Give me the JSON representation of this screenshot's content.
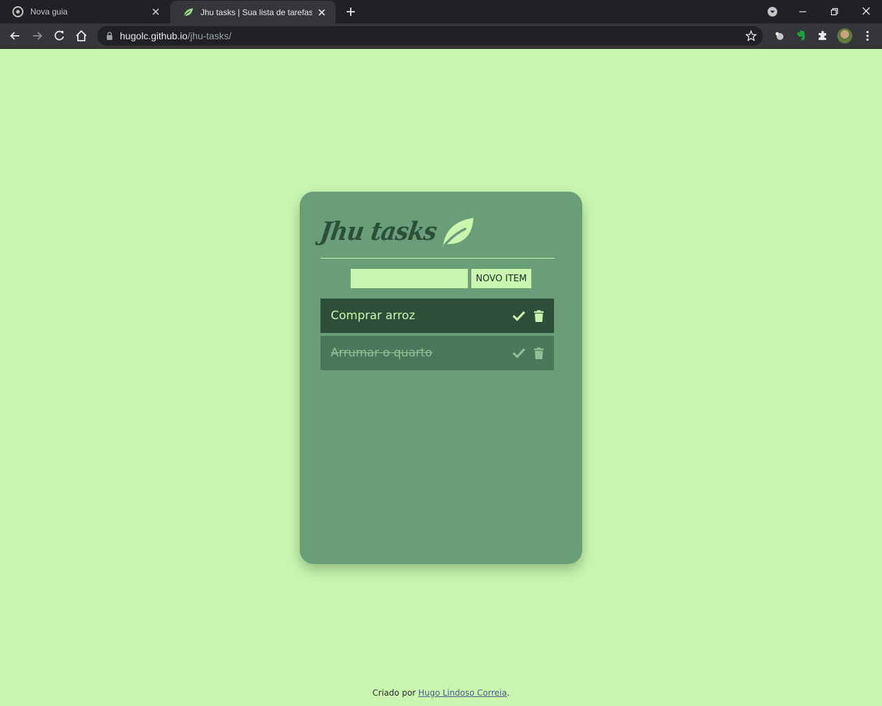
{
  "browser": {
    "tabs": [
      {
        "title": "Nova guia",
        "icon": "chrome-icon",
        "active": false
      },
      {
        "title": "Jhu tasks | Sua lista de tarefas mi",
        "icon": "leaf-icon",
        "active": true
      }
    ],
    "url_host": "hugolc.github.io",
    "url_path": "/jhu-tasks/"
  },
  "app": {
    "title": "Jhu tasks",
    "new_item_button": "NOVO ITEM",
    "new_item_value": "",
    "tasks": [
      {
        "text": "Comprar arroz",
        "done": false
      },
      {
        "text": "Arrumar o quarto",
        "done": true
      }
    ]
  },
  "footer": {
    "prefix": "Criado por ",
    "author": "Hugo Lindoso Correia",
    "suffix": "."
  },
  "colors": {
    "background": "#c9f7b0",
    "card": "#6a9e78",
    "task_active": "#2d4f39",
    "task_done": "#4b775b",
    "title_dark": "#2b4f38"
  }
}
